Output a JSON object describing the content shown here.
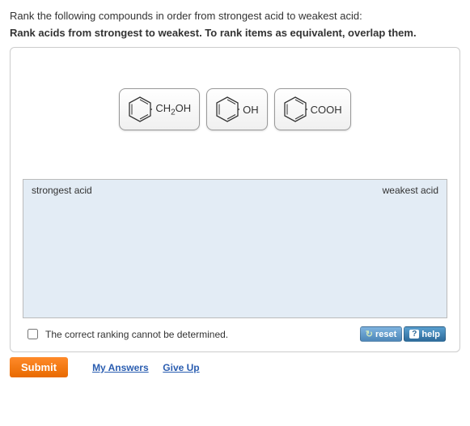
{
  "question": "Rank the following compounds in order from strongest acid to weakest acid:",
  "instruction": "Rank acids from strongest to weakest. To rank items as equivalent, overlap them.",
  "items": [
    {
      "label_html": "CH<sub>2</sub>OH"
    },
    {
      "label_html": "OH"
    },
    {
      "label_html": "COOH"
    }
  ],
  "zone": {
    "left_label": "strongest acid",
    "right_label": "weakest acid"
  },
  "checkbox_label": "The correct ranking cannot be determined.",
  "buttons": {
    "reset": "reset",
    "help": "help",
    "submit": "Submit",
    "my_answers": "My Answers",
    "give_up": "Give Up"
  }
}
